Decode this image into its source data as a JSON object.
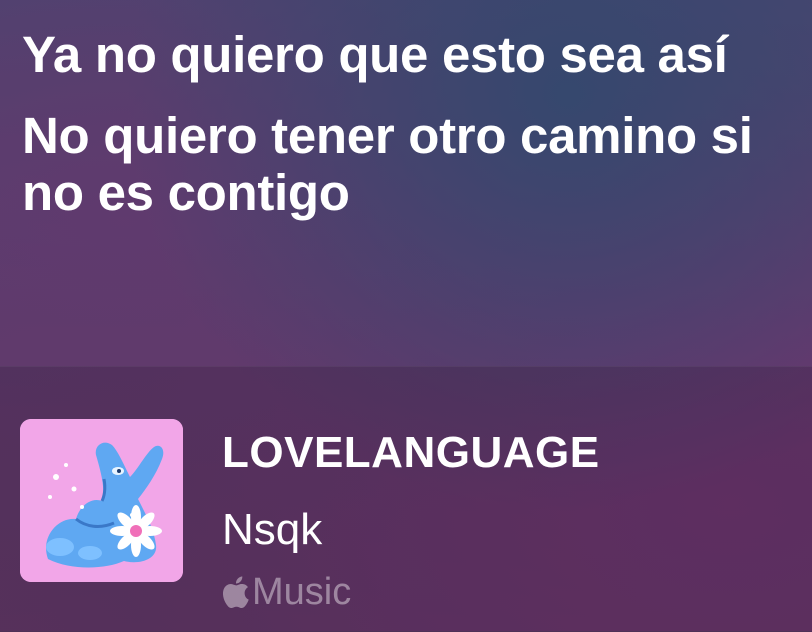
{
  "lyrics": [
    {
      "text": "Ya no quiero que esto sea así"
    },
    {
      "text": "No quiero tener otro camino si no es contigo"
    }
  ],
  "now_playing": {
    "title": "LOVELANGUAGE",
    "artist": "Nsqk",
    "service_label": "Music",
    "service_icon": "apple-logo-icon",
    "artwork_icon": "album-artwork"
  },
  "colors": {
    "text": "#ffffff",
    "service_text": "#ffffff6b",
    "artwork_background": "#f2a6e8",
    "artwork_figure": "#5fa8f2"
  }
}
